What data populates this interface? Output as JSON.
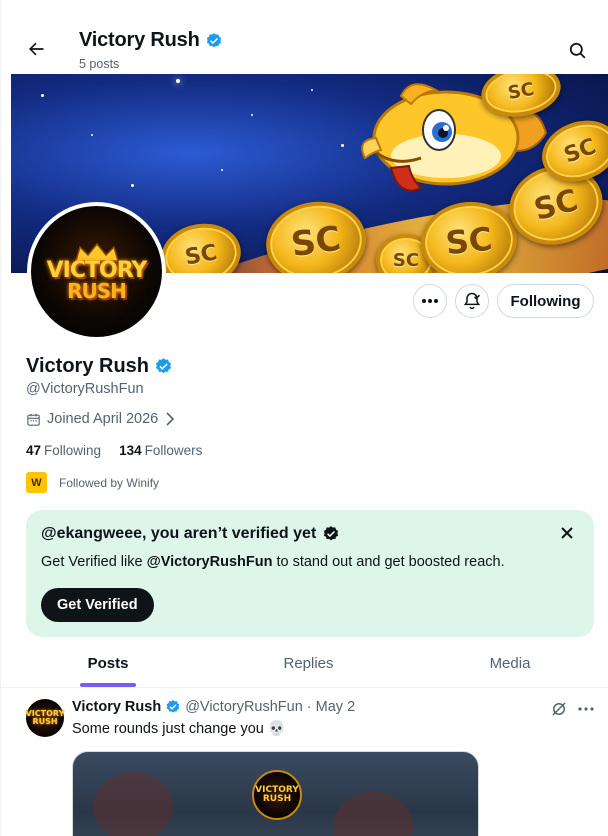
{
  "header": {
    "title": "Victory Rush",
    "posts_count": "5 posts"
  },
  "banner": {
    "coin_label": "SC"
  },
  "avatar": {
    "logo_line1": "VICTORY",
    "logo_line2": "RUSH"
  },
  "actions": {
    "following_label": "Following"
  },
  "profile": {
    "name": "Victory Rush",
    "handle": "@VictoryRushFun",
    "joined": "Joined April 2026",
    "following_count": "47",
    "following_label": "Following",
    "followers_count": "134",
    "followers_label": "Followers",
    "followed_by": "Followed by Winify"
  },
  "verify_card": {
    "title": "@ekangweee, you aren’t verified yet",
    "body_prefix": "Get Verified like ",
    "body_handle": "@VictoryRushFun",
    "body_suffix": " to stand out and get boosted reach.",
    "button": "Get Verified"
  },
  "tabs": [
    {
      "label": "Posts",
      "active": true
    },
    {
      "label": "Replies",
      "active": false
    },
    {
      "label": "Media",
      "active": false
    }
  ],
  "post": {
    "name": "Victory Rush",
    "handle": "@VictoryRushFun",
    "date": "· May 2",
    "text": "Some rounds just change you 💀"
  },
  "colors": {
    "verified_blue": "#1d9bf0",
    "verify_card_bg": "#def5ea",
    "tab_indicator": "#7b5cf0"
  }
}
